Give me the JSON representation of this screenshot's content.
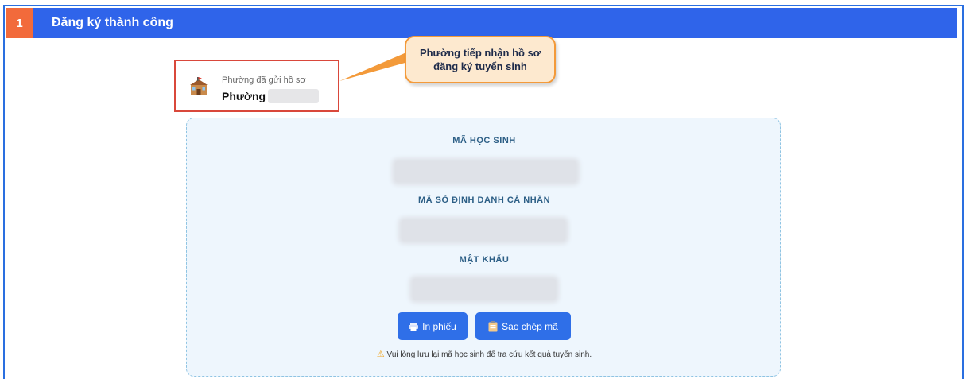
{
  "header": {
    "step_number": "1",
    "title": "Đăng ký thành công"
  },
  "ward": {
    "caption": "Phường đã gửi hồ sơ",
    "name_prefix": "Phường",
    "icon": "school-building-icon"
  },
  "callout": {
    "text": "Phường tiếp nhận hồ sơ đăng ký tuyển sinh"
  },
  "fields": {
    "student_code_label": "MÃ HỌC SINH",
    "personal_id_label": "MÃ SỐ ĐỊNH DANH CÁ NHÂN",
    "password_label": "MẬT KHẨU"
  },
  "actions": {
    "print_label": "In phiếu",
    "print_icon": "printer-icon",
    "copy_label": "Sao chép mã",
    "copy_icon": "clipboard-icon"
  },
  "notice": {
    "text": "Vui lòng lưu lại mã học sinh để tra cứu kết quả tuyển sinh.",
    "icon": "warning-icon"
  },
  "colors": {
    "header_bg": "#2f64ea",
    "step_bg": "#f26a3b",
    "highlight_border": "#d9483b",
    "callout_bg": "#fde9cf",
    "button_bg": "#2f6fe8"
  }
}
